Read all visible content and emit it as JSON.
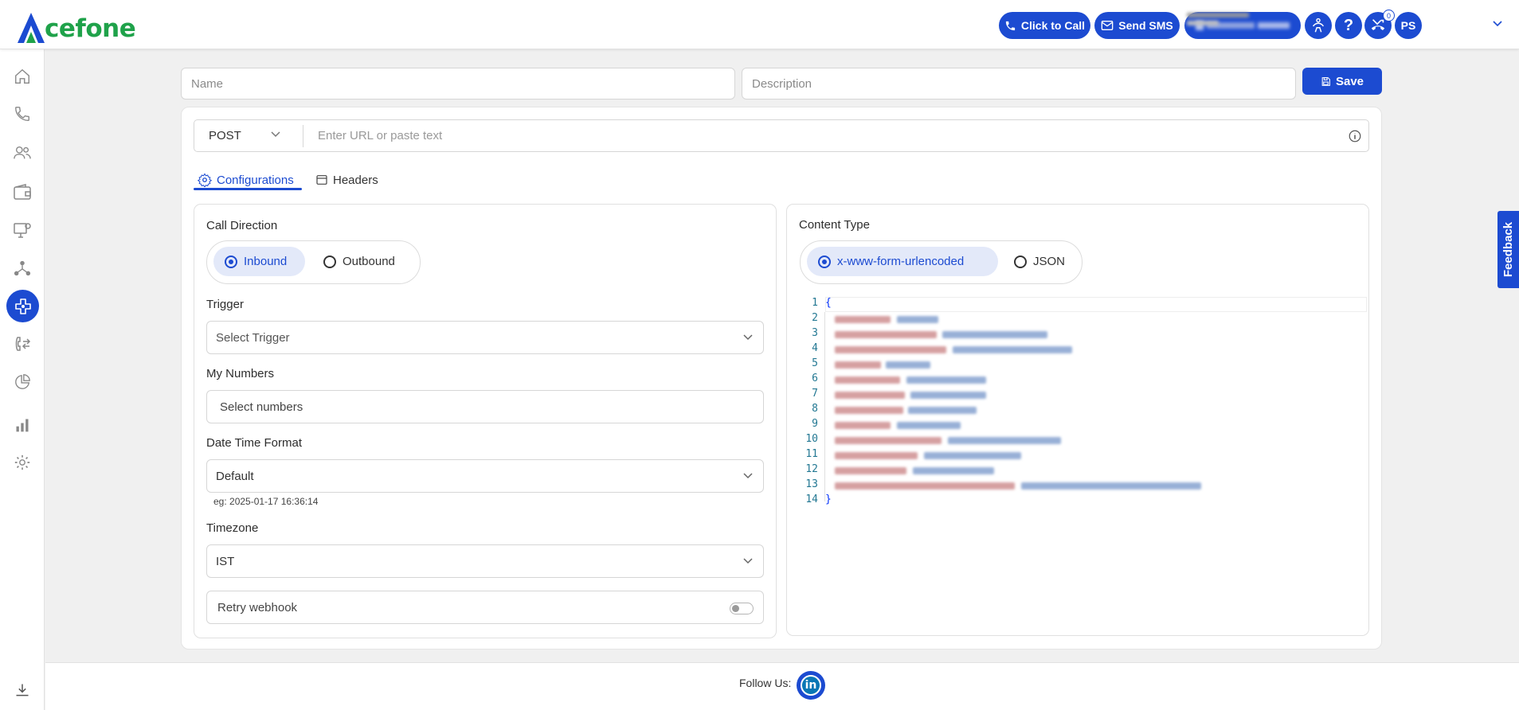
{
  "brand": {
    "logo_text": "cefone",
    "logo_letter": "A"
  },
  "header": {
    "click_to_call": "Click to Call",
    "send_sms": "Send SMS",
    "help": "?",
    "notification_count": "0",
    "avatar_initials": "PS"
  },
  "sidebar": {
    "items": [
      "home",
      "calls",
      "contacts",
      "wallet",
      "monitor",
      "network",
      "integrations",
      "call-forward",
      "reports-pie",
      "analytics",
      "settings",
      "download"
    ],
    "active": "integrations"
  },
  "form": {
    "name_placeholder": "Name",
    "description_placeholder": "Description",
    "save_label": "Save",
    "method": "POST",
    "url_placeholder": "Enter URL or paste text"
  },
  "tabs": [
    {
      "label": "Configurations",
      "active": true
    },
    {
      "label": "Headers",
      "active": false
    }
  ],
  "config": {
    "call_direction_label": "Call Direction",
    "call_direction_options": [
      "Inbound",
      "Outbound"
    ],
    "call_direction_selected": "Inbound",
    "trigger_label": "Trigger",
    "trigger_value": "Select Trigger",
    "my_numbers_label": "My Numbers",
    "my_numbers_value": "Select numbers",
    "date_format_label": "Date Time Format",
    "date_format_value": "Default",
    "date_format_hint": "eg: 2025-01-17 16:36:14",
    "timezone_label": "Timezone",
    "timezone_value": "IST",
    "retry_label": "Retry webhook",
    "retry_enabled": false
  },
  "content": {
    "label": "Content Type",
    "options": [
      "x-www-form-urlencoded",
      "JSON"
    ],
    "selected": "x-www-form-urlencoded",
    "editor_lines": [
      "1",
      "2",
      "3",
      "4",
      "5",
      "6",
      "7",
      "8",
      "9",
      "10",
      "11",
      "12",
      "13",
      "14"
    ],
    "open_brace": "{",
    "close_brace": "}"
  },
  "feedback_label": "Feedback",
  "footer": {
    "follow_label": "Follow Us:",
    "linkedin_text": "in"
  },
  "colors": {
    "primary": "#1c4bd1",
    "brand_green": "#1fa24a"
  }
}
